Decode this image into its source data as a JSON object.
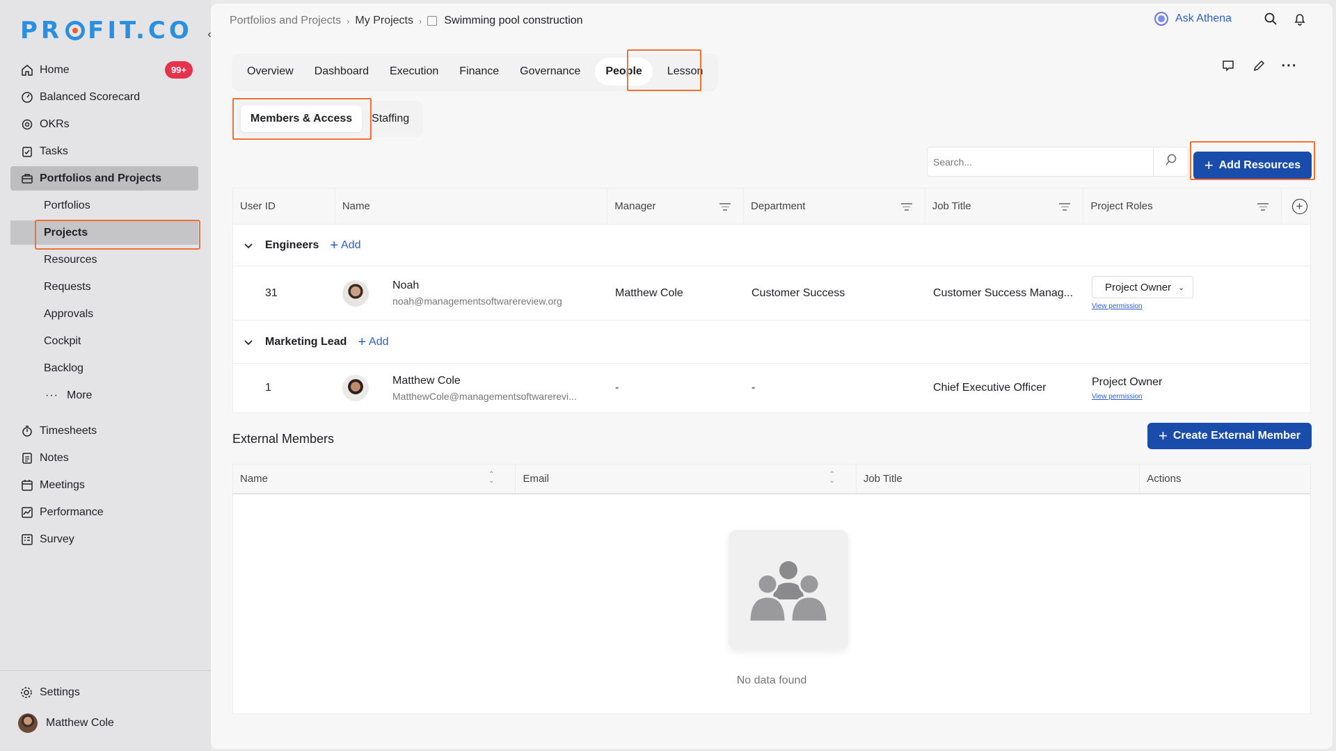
{
  "brand": {
    "logo_left": "PR",
    "logo_right": "FIT.CO"
  },
  "sidebar": {
    "items": [
      {
        "label": "Home",
        "badge": "99+"
      },
      {
        "label": "Balanced Scorecard"
      },
      {
        "label": "OKRs"
      },
      {
        "label": "Tasks"
      },
      {
        "label": "Portfolios and Projects"
      }
    ],
    "sub_items": [
      "Portfolios",
      "Projects",
      "Resources",
      "Requests",
      "Approvals",
      "Cockpit",
      "Backlog",
      "More"
    ],
    "lower_items": [
      "Timesheets",
      "Notes",
      "Meetings",
      "Performance",
      "Survey"
    ],
    "settings": "Settings",
    "user_name": "Matthew Cole"
  },
  "breadcrumb": {
    "b1": "Portfolios and Projects",
    "b2": "My Projects",
    "b3": "Swimming pool construction"
  },
  "header": {
    "ask": "Ask Athena"
  },
  "tabs": [
    "Overview",
    "Dashboard",
    "Execution",
    "Finance",
    "Governance",
    "People",
    "Lesson"
  ],
  "subtabs": [
    "Members & Access",
    "Staffing"
  ],
  "search": {
    "placeholder": "Search..."
  },
  "add_resources": "Add Resources",
  "members_table": {
    "headers": [
      "User ID",
      "Name",
      "Manager",
      "Department",
      "Job Title",
      "Project Roles"
    ],
    "groups": [
      {
        "name": "Engineers",
        "add": "Add",
        "row": {
          "uid": "31",
          "name": "Noah",
          "email": "noah@managementsoftwarereview.org",
          "manager": "Matthew Cole",
          "department": "Customer Success",
          "job": "Customer Success Manag...",
          "role": "Project Owner",
          "perm": "View permission"
        }
      },
      {
        "name": "Marketing Lead",
        "add": "Add",
        "row": {
          "uid": "1",
          "name": "Matthew Cole",
          "email": "MatthewCole@managementsoftwarerevi...",
          "manager": "-",
          "department": "-",
          "job": "Chief Executive Officer",
          "role": "Project Owner",
          "perm": "View permission"
        }
      }
    ]
  },
  "external": {
    "title": "External Members",
    "create": "Create External Member",
    "headers": [
      "Name",
      "Email",
      "Job Title",
      "Actions"
    ],
    "empty": "No data found"
  }
}
